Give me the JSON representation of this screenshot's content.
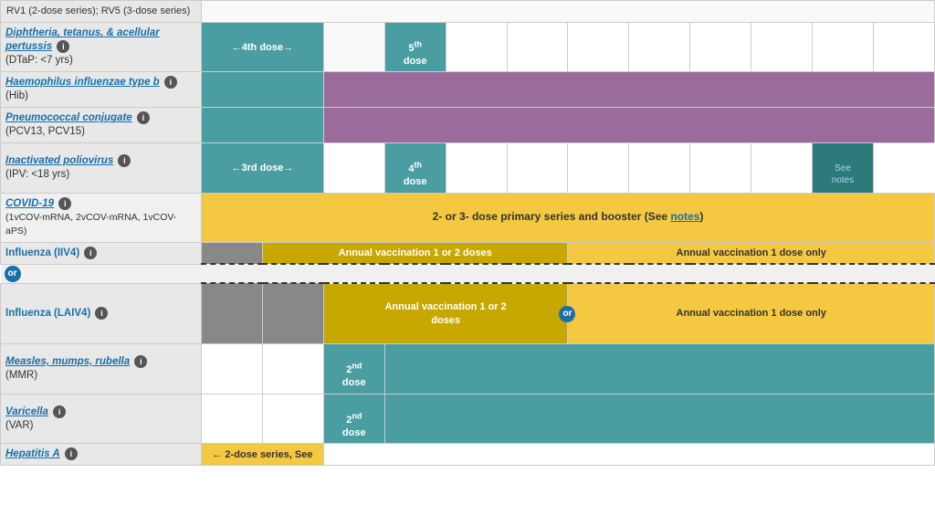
{
  "rows": [
    {
      "id": "rv",
      "name": "RV1 (2-dose series); RV5 (3-dose series)",
      "isLink": false,
      "subtitle": "",
      "cells": [
        {
          "span": 1,
          "class": "empty",
          "text": ""
        },
        {
          "span": 1,
          "class": "empty",
          "text": ""
        },
        {
          "span": 1,
          "class": "empty",
          "text": ""
        },
        {
          "span": 1,
          "class": "empty",
          "text": ""
        },
        {
          "span": 1,
          "class": "empty",
          "text": ""
        },
        {
          "span": 1,
          "class": "empty",
          "text": ""
        },
        {
          "span": 1,
          "class": "empty",
          "text": ""
        },
        {
          "span": 1,
          "class": "empty",
          "text": ""
        },
        {
          "span": 1,
          "class": "empty",
          "text": ""
        },
        {
          "span": 1,
          "class": "empty",
          "text": ""
        },
        {
          "span": 1,
          "class": "empty",
          "text": ""
        },
        {
          "span": 1,
          "class": "empty",
          "text": ""
        }
      ]
    },
    {
      "id": "dtap",
      "name": "Diphtheria, tetanus, & acellular pertussis",
      "isLink": true,
      "subtitle": "(DTaP: <7 yrs)",
      "cells": [
        {
          "span": 2,
          "class": "teal",
          "text": "←4th dose→"
        },
        {
          "span": 1,
          "class": "empty",
          "text": ""
        },
        {
          "span": 1,
          "class": "teal",
          "text": "5th\ndose"
        },
        {
          "span": 1,
          "class": "empty",
          "text": ""
        },
        {
          "span": 1,
          "class": "empty",
          "text": ""
        },
        {
          "span": 1,
          "class": "empty",
          "text": ""
        },
        {
          "span": 1,
          "class": "empty",
          "text": ""
        },
        {
          "span": 1,
          "class": "empty",
          "text": ""
        },
        {
          "span": 1,
          "class": "empty",
          "text": ""
        },
        {
          "span": 1,
          "class": "empty",
          "text": ""
        },
        {
          "span": 1,
          "class": "empty",
          "text": ""
        }
      ]
    },
    {
      "id": "hib",
      "name": "Haemophilus influenzae type b",
      "isLink": true,
      "subtitle": "(Hib)",
      "cells": [
        {
          "span": 2,
          "class": "teal",
          "text": ""
        },
        {
          "span": 9,
          "class": "purple",
          "text": ""
        }
      ]
    },
    {
      "id": "pcv",
      "name": "Pneumococcal conjugate",
      "isLink": false,
      "subtitle": "(PCV13, PCV15)",
      "cells": [
        {
          "span": 2,
          "class": "teal",
          "text": ""
        },
        {
          "span": 9,
          "class": "purple",
          "text": ""
        }
      ]
    },
    {
      "id": "ipv",
      "name": "Inactivated poliovirus",
      "isLink": true,
      "subtitle": "(IPV: <18 yrs)",
      "cells": [
        {
          "span": 2,
          "class": "teal",
          "text": "←3rd dose→"
        },
        {
          "span": 1,
          "class": "empty",
          "text": ""
        },
        {
          "span": 1,
          "class": "teal",
          "text": "4th\ndose"
        },
        {
          "span": 1,
          "class": "empty",
          "text": ""
        },
        {
          "span": 1,
          "class": "empty",
          "text": ""
        },
        {
          "span": 1,
          "class": "empty",
          "text": ""
        },
        {
          "span": 1,
          "class": "empty",
          "text": ""
        },
        {
          "span": 1,
          "class": "empty",
          "text": ""
        },
        {
          "span": 1,
          "class": "empty",
          "text": ""
        },
        {
          "span": 1,
          "class": "teal-dark",
          "text": "See\nnotes"
        }
      ]
    },
    {
      "id": "covid",
      "name": "COVID-19",
      "isLink": true,
      "subtitle": "(1vCOV-mRNA, 2vCOV-mRNA, 1vCOV-aPS)",
      "cells": [
        {
          "span": 12,
          "class": "yellow",
          "text": "2- or 3- dose primary series and booster (See notes)",
          "notesLink": true
        }
      ]
    },
    {
      "id": "influenza_iiv4",
      "name": "Influenza (IIV4)",
      "isLink": false,
      "subtitle": "",
      "cells": [
        {
          "span": 1,
          "class": "gray",
          "text": ""
        },
        {
          "span": 5,
          "class": "yellow-dark",
          "text": "Annual vaccination 1 or 2 doses"
        },
        {
          "span": 6,
          "class": "yellow",
          "text": "Annual vaccination 1 dose only"
        }
      ]
    },
    {
      "id": "influenza_laiv4",
      "name": "Influenza (LAIV4)",
      "isLink": false,
      "subtitle": "",
      "isDashed": true,
      "hasOr": true,
      "hasOrRight": true,
      "cells": [
        {
          "span": 1,
          "class": "gray",
          "text": ""
        },
        {
          "span": 1,
          "class": "gray",
          "text": ""
        },
        {
          "span": 3,
          "class": "yellow-dark",
          "text": "Annual vaccination 1 or 2\ndoses"
        },
        {
          "span": 6,
          "class": "yellow",
          "text": "Annual vaccination 1 dose only"
        }
      ]
    },
    {
      "id": "mmr",
      "name": "Measles, mumps, rubella",
      "isLink": true,
      "subtitle": "(MMR)",
      "cells": [
        {
          "span": 1,
          "class": "empty",
          "text": ""
        },
        {
          "span": 1,
          "class": "empty",
          "text": ""
        },
        {
          "span": 1,
          "class": "teal",
          "text": "2nd\ndose"
        },
        {
          "span": 9,
          "class": "teal",
          "text": ""
        }
      ]
    },
    {
      "id": "varicella",
      "name": "Varicella",
      "isLink": true,
      "subtitle": "(VAR)",
      "cells": [
        {
          "span": 1,
          "class": "empty",
          "text": ""
        },
        {
          "span": 1,
          "class": "empty",
          "text": ""
        },
        {
          "span": 1,
          "class": "teal",
          "text": "2nd\ndose"
        },
        {
          "span": 9,
          "class": "teal",
          "text": ""
        }
      ]
    },
    {
      "id": "hepa",
      "name": "Hepatitis A",
      "isLink": true,
      "subtitle": "",
      "cells": [
        {
          "span": 2,
          "class": "yellow",
          "text": "← 2-dose series, See"
        },
        {
          "span": 10,
          "class": "empty",
          "text": ""
        }
      ]
    }
  ],
  "labels": {
    "rv_text": "RV1 (2-dose series); RV5 (3-dose series)",
    "dtap_name": "Diphtheria, tetanus, & acellular pertussis",
    "dtap_subtitle": "(DTaP: <7 yrs)",
    "hib_name": "Haemophilus influenzae type b",
    "hib_subtitle": "(Hib)",
    "pcv_name": "Pneumococcal conjugate",
    "pcv_subtitle": "(PCV13, PCV15)",
    "ipv_name": "Inactivated poliovirus",
    "ipv_subtitle": "(IPV: <18 yrs)",
    "covid_name": "COVID-19",
    "covid_subtitle": "(1vCOV-mRNA, 2vCOV-mRNA, 1vCOV-aPS)",
    "influenza_iiv4_name": "Influenza (IIV4)",
    "influenza_laiv4_name": "Influenza (LAIV4)",
    "mmr_name": "Measles, mumps, rubella",
    "mmr_subtitle": "(MMR)",
    "varicella_name": "Varicella",
    "varicella_subtitle": "(VAR)",
    "hepa_name": "Hepatitis A",
    "dtap_dose4": "←4th dose→",
    "dtap_dose5": "5th\ndose",
    "ipv_dose3": "←3rd dose→",
    "ipv_dose4": "4th\ndose",
    "ipv_seenotes": "See\nnotes",
    "covid_text": "2- or 3- dose primary series and booster (See notes)",
    "iiv4_annual1": "Annual vaccination 1 or 2 doses",
    "iiv4_annual2": "Annual vaccination 1 dose only",
    "laiv4_annual1": "Annual vaccination 1 or 2\ndoses",
    "laiv4_annual2": "Annual vaccination 1 dose only",
    "mmr_dose2": "2nd\ndose",
    "var_dose2": "2nd\ndose",
    "hepa_series": "← 2-dose series, See",
    "or_label": "or",
    "notes_link": "notes"
  }
}
